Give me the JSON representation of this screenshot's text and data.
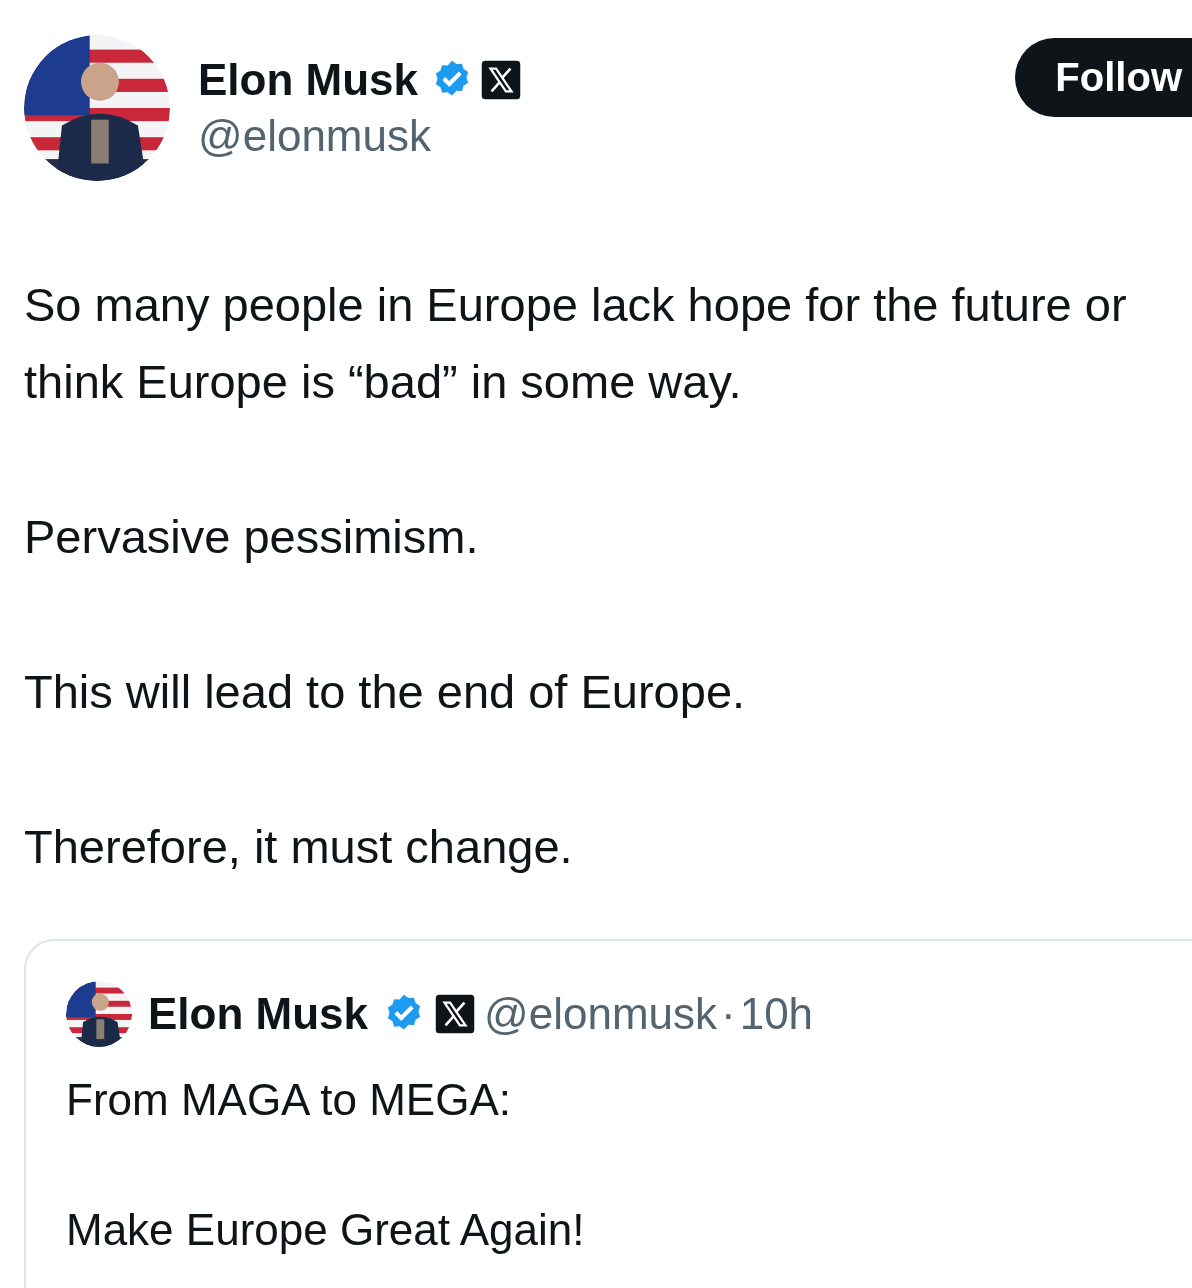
{
  "author": {
    "name": "Elon Musk",
    "handle": "@elonmusk",
    "verified": true,
    "affiliated": true
  },
  "follow_button": {
    "label": "Follow"
  },
  "paragraphs": [
    "So many people in Europe lack hope for the future or think Europe is “bad” in some way.",
    "Pervasive pessimism.",
    "This will lead to the end of Europe.",
    "Therefore, it must change."
  ],
  "quoted_post": {
    "author": {
      "name": "Elon Musk",
      "handle": "@elonmusk",
      "verified": true,
      "affiliated": true
    },
    "separator": "·",
    "time": "10h",
    "paragraphs": [
      "From MAGA to MEGA:",
      "Make Europe Great Again!"
    ]
  }
}
